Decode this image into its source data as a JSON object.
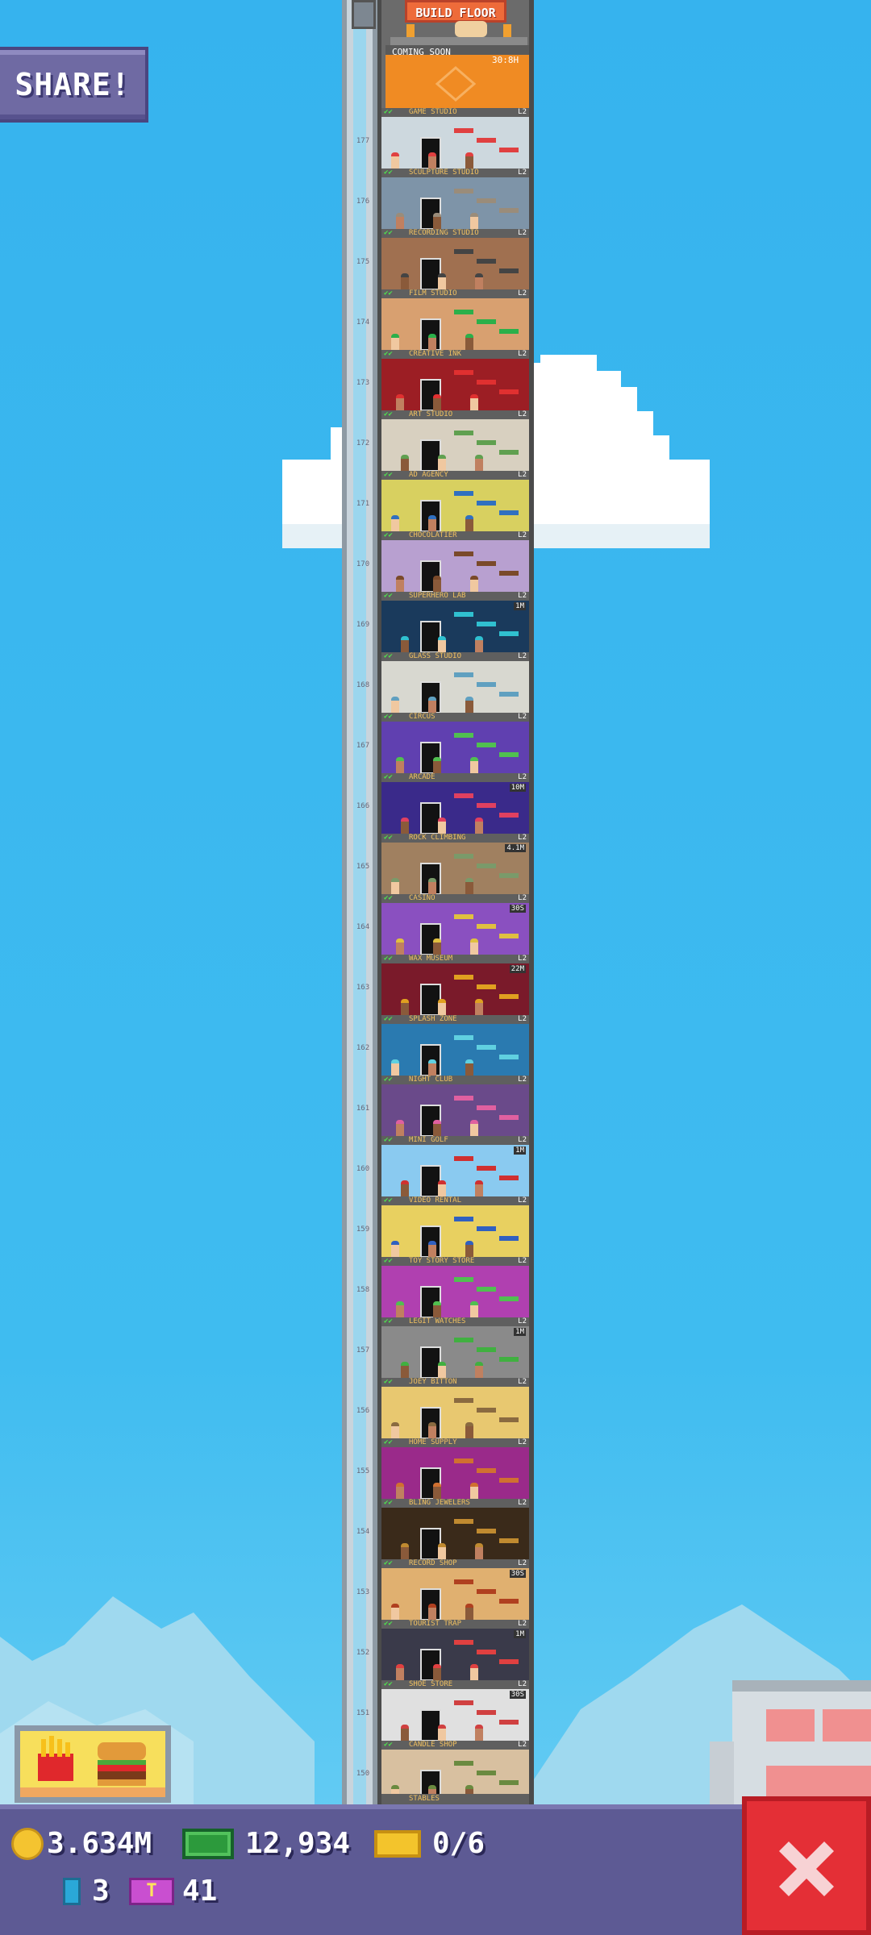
{
  "share_button": {
    "label": "SHARE!"
  },
  "top": {
    "build_floor_label": "BUILD FLOOR",
    "coming_soon_label": "COMING SOON",
    "coming_soon_timer": "30:8H"
  },
  "floors": [
    {
      "num": "177",
      "name": "GAME STUDIO",
      "level": "L2",
      "badge": "",
      "bg": "#cdd8de",
      "accent": "#e04040"
    },
    {
      "num": "176",
      "name": "SCULPTURE STUDIO",
      "level": "L2",
      "badge": "",
      "bg": "#7e94a8",
      "accent": "#9a8c7a"
    },
    {
      "num": "175",
      "name": "RECORDING STUDIO",
      "level": "L2",
      "badge": "",
      "bg": "#a07050",
      "accent": "#444444"
    },
    {
      "num": "174",
      "name": "FILM STUDIO",
      "level": "L2",
      "badge": "",
      "bg": "#d8a070",
      "accent": "#2bb04a"
    },
    {
      "num": "173",
      "name": "CREATIVE INK",
      "level": "L2",
      "badge": "",
      "bg": "#9c1e24",
      "accent": "#e03030"
    },
    {
      "num": "172",
      "name": "ART STUDIO",
      "level": "L2",
      "badge": "",
      "bg": "#d8d0c0",
      "accent": "#60a050"
    },
    {
      "num": "171",
      "name": "AD AGENCY",
      "level": "L2",
      "badge": "",
      "bg": "#d8d060",
      "accent": "#3070c0"
    },
    {
      "num": "170",
      "name": "CHOCOLATIER",
      "level": "L2",
      "badge": "",
      "bg": "#b8a0d0",
      "accent": "#7a4a2a"
    },
    {
      "num": "169",
      "name": "SUPERHERO LAB",
      "level": "L2",
      "badge": "1M",
      "bg": "#1a3a5c",
      "accent": "#30c0d0"
    },
    {
      "num": "168",
      "name": "GLASS STUDIO",
      "level": "L2",
      "badge": "",
      "bg": "#d8d8d0",
      "accent": "#60a0c0"
    },
    {
      "num": "167",
      "name": "CIRCUS",
      "level": "L2",
      "badge": "",
      "bg": "#6040b0",
      "accent": "#50c050"
    },
    {
      "num": "166",
      "name": "ARCADE",
      "level": "L2",
      "badge": "10M",
      "bg": "#3a2a8a",
      "accent": "#e04060"
    },
    {
      "num": "165",
      "name": "ROCK CLIMBING",
      "level": "L2",
      "badge": "4.1M",
      "bg": "#a08060",
      "accent": "#7a9a6a"
    },
    {
      "num": "164",
      "name": "CASINO",
      "level": "L2",
      "badge": "30S",
      "bg": "#8a50c0",
      "accent": "#e0c040"
    },
    {
      "num": "163",
      "name": "WAX MUSEUM",
      "level": "L2",
      "badge": "22M",
      "bg": "#7a1a2a",
      "accent": "#e0a020"
    },
    {
      "num": "162",
      "name": "SPLASH ZONE",
      "level": "L2",
      "badge": "",
      "bg": "#2a7ab0",
      "accent": "#60d0e0"
    },
    {
      "num": "161",
      "name": "NIGHT CLUB",
      "level": "L2",
      "badge": "",
      "bg": "#6a4a8a",
      "accent": "#e060a0"
    },
    {
      "num": "160",
      "name": "MINI GOLF",
      "level": "L2",
      "badge": "1M",
      "bg": "#8acaf0",
      "accent": "#d03030"
    },
    {
      "num": "159",
      "name": "VIDEO RENTAL",
      "level": "L2",
      "badge": "",
      "bg": "#e8d060",
      "accent": "#3060c0"
    },
    {
      "num": "158",
      "name": "TOY STORY STORE",
      "level": "L2",
      "badge": "",
      "bg": "#b040b0",
      "accent": "#50c050"
    },
    {
      "num": "157",
      "name": "LEGIT WATCHES",
      "level": "L2",
      "badge": "1M",
      "bg": "#8a8a8a",
      "accent": "#40b040"
    },
    {
      "num": "156",
      "name": "JOEY BITTON",
      "level": "L2",
      "badge": "",
      "bg": "#e8c870",
      "accent": "#8a6a40"
    },
    {
      "num": "155",
      "name": "HOME SUPPLY",
      "level": "L2",
      "badge": "",
      "bg": "#9a2a8a",
      "accent": "#d07030"
    },
    {
      "num": "154",
      "name": "BLING JEWELERS",
      "level": "L2",
      "badge": "",
      "bg": "#3a2a1a",
      "accent": "#c08a30"
    },
    {
      "num": "153",
      "name": "RECORD SHOP",
      "level": "L2",
      "badge": "30S",
      "bg": "#e0b070",
      "accent": "#b04020"
    },
    {
      "num": "152",
      "name": "TOURIST TRAP",
      "level": "L2",
      "badge": "1M",
      "bg": "#3a3a4a",
      "accent": "#e04040"
    },
    {
      "num": "151",
      "name": "SHOE STORE",
      "level": "L2",
      "badge": "30S",
      "bg": "#e0e0e0",
      "accent": "#d04040"
    },
    {
      "num": "150",
      "name": "CANDLE SHOP",
      "level": "L2",
      "badge": "",
      "bg": "#d8c0a0",
      "accent": "#6a8a40"
    }
  ],
  "next_floor_label": "STABLES",
  "stats": {
    "coins": "3.634M",
    "bux": "12,934",
    "tickets": "0/6",
    "gems": "3",
    "vip": "41"
  },
  "icons": {
    "coin": "coin-icon",
    "bux": "bux-icon",
    "ticket": "ticket-icon",
    "gem": "gem-icon",
    "vip": "vip-icon",
    "close": "close-icon"
  },
  "colors": {
    "sky": "#3cb7ee",
    "panel": "#5d5a94",
    "close": "#e42f36"
  }
}
